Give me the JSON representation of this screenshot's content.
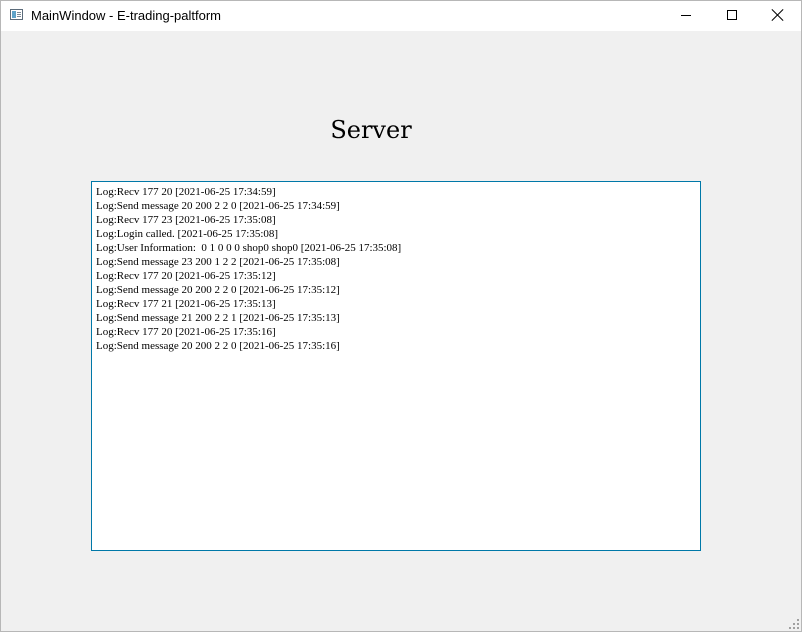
{
  "window": {
    "title": "MainWindow - E-trading-paltform"
  },
  "heading": "Server",
  "log": {
    "lines": [
      "Log:Recv 177 20 [2021-06-25 17:34:59]",
      "Log:Send message 20 200 2 2 0 [2021-06-25 17:34:59]",
      "Log:Recv 177 23 [2021-06-25 17:35:08]",
      "Log:Login called. [2021-06-25 17:35:08]",
      "Log:User Information:  0 1 0 0 0 shop0 shop0 [2021-06-25 17:35:08]",
      "Log:Send message 23 200 1 2 2 [2021-06-25 17:35:08]",
      "Log:Recv 177 20 [2021-06-25 17:35:12]",
      "Log:Send message 20 200 2 2 0 [2021-06-25 17:35:12]",
      "Log:Recv 177 21 [2021-06-25 17:35:13]",
      "Log:Send message 21 200 2 2 1 [2021-06-25 17:35:13]",
      "Log:Recv 177 20 [2021-06-25 17:35:16]",
      "Log:Send message 20 200 2 2 0 [2021-06-25 17:35:16]"
    ]
  },
  "icons": {
    "app": "app-window-icon",
    "minimize": "minimize-icon",
    "maximize": "maximize-icon",
    "close": "close-icon",
    "grip": "resize-grip-icon"
  },
  "colors": {
    "window_bg": "#f0f0f0",
    "titlebar_bg": "#ffffff",
    "log_border": "#0078a8",
    "log_bg": "#ffffff"
  }
}
